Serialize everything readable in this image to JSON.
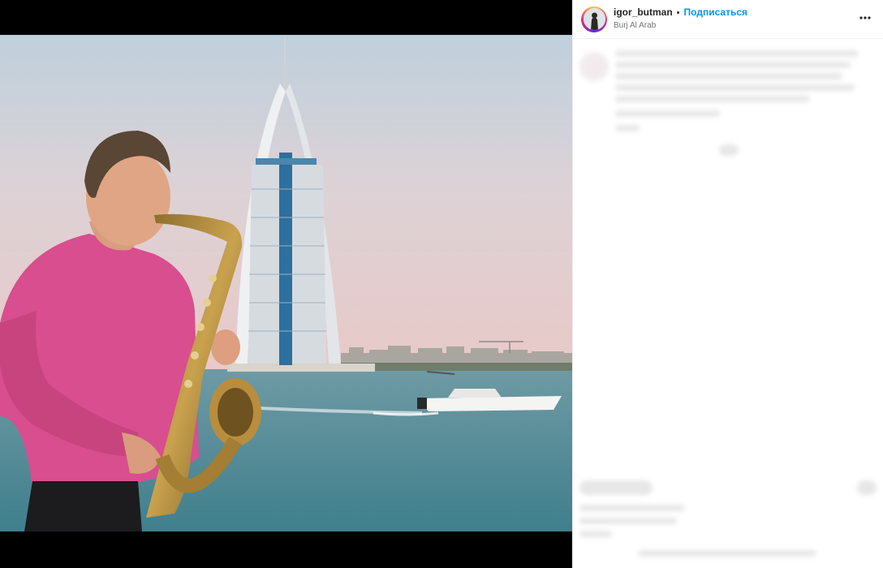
{
  "post": {
    "username": "igor_butman",
    "separator": "•",
    "follow_label": "Подписаться",
    "location": "Burj Al Arab"
  },
  "icons": {
    "more": "more-horizontal-icon",
    "avatar": "profile-photo"
  },
  "colors": {
    "follow_blue": "#0095f6",
    "text_primary": "#262626",
    "text_secondary": "#737373",
    "media_background": "#000000"
  }
}
